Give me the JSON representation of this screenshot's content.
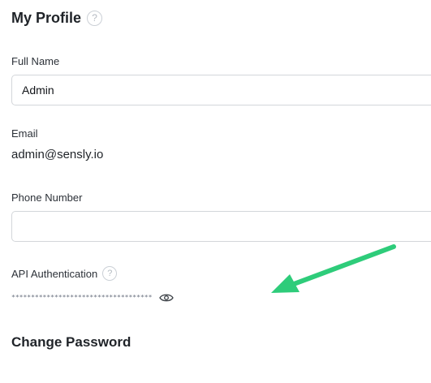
{
  "profile": {
    "title": "My Profile",
    "help_glyph": "?"
  },
  "full_name": {
    "label": "Full Name",
    "value": "Admin"
  },
  "email": {
    "label": "Email",
    "value": "admin@sensly.io"
  },
  "phone": {
    "label": "Phone Number",
    "value": "",
    "placeholder": ""
  },
  "api": {
    "label": "API Authentication",
    "help_glyph": "?",
    "masked_key": "************************************",
    "reveal_icon": "eye-icon"
  },
  "change_password": {
    "title": "Change Password"
  },
  "annotation": {
    "arrow_color": "#2ecc7a"
  }
}
